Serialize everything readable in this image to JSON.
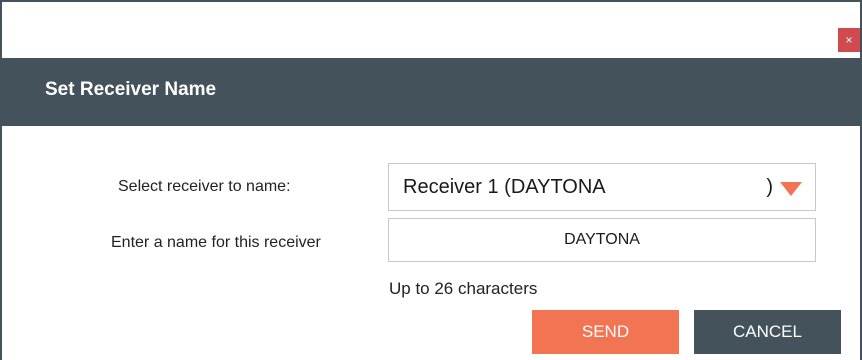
{
  "dialog": {
    "title": "Set Receiver Name",
    "close_glyph": "×",
    "close_icon": "close-icon"
  },
  "form": {
    "select_label": "Select receiver to name:",
    "select_value": "Receiver 1 (DAYTONA",
    "select_suffix": ")",
    "dropdown_icon": "triangle-down-icon",
    "name_label": "Enter a name for this receiver",
    "name_value": "DAYTONA",
    "hint": "Up to 26 characters"
  },
  "buttons": {
    "send": "SEND",
    "cancel": "CANCEL"
  },
  "colors": {
    "header_bg": "#44525b",
    "accent": "#f27452",
    "close_bg": "#cf4b4f"
  }
}
